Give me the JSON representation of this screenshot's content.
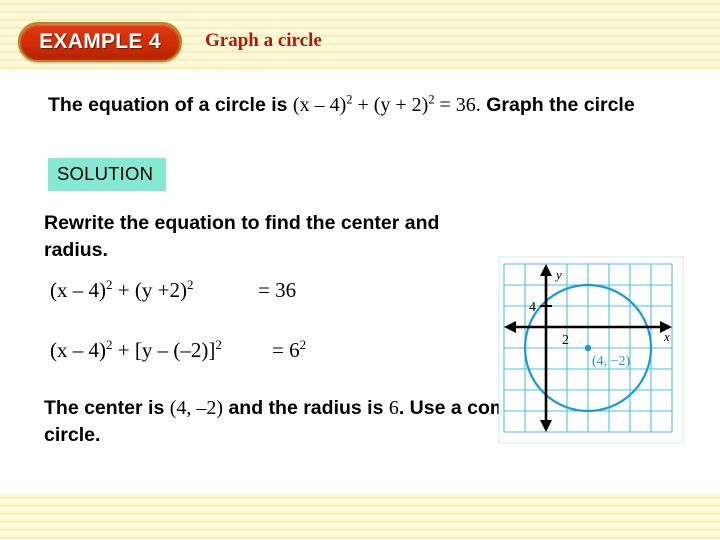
{
  "header": {
    "badge_label": "EXAMPLE 4",
    "title": "Graph a circle"
  },
  "problem": {
    "lead": "The equation of a circle is ",
    "equation": "(x – 4)² + (y + 2)² = 36.",
    "equation_parts": {
      "p1": "(x – 4)",
      "e1": "2",
      "p2": " + (y + 2)",
      "e2": "2",
      "p3": " = 36."
    },
    "trail": " Graph the circle"
  },
  "solution": {
    "label": "SOLUTION",
    "background_color": "#85e8d0"
  },
  "steps": {
    "instruction": "Rewrite the equation to find the center and radius.",
    "equation_1": {
      "lhs_p1": "(x – 4)",
      "lhs_e1": "2",
      "lhs_p2": " + (y +2)",
      "lhs_e2": "2",
      "rhs": "=  36"
    },
    "equation_2": {
      "lhs_p1": "(x – 4)",
      "lhs_e1": "2",
      "lhs_p2": " + [y – (–2)]",
      "lhs_e2": "2",
      "rhs_eq": "=  6",
      "rhs_exp": "2"
    }
  },
  "conclusion": {
    "part1": "The center is ",
    "center": "(4, –2)",
    "part2": " and the radius is ",
    "radius": "6",
    "part3": ". Use a compass to graph the circle."
  },
  "chart_data": {
    "type": "scatter",
    "title": "",
    "xlabel": "x",
    "ylabel": "y",
    "grid": true,
    "grid_step_units": 2,
    "xlim": [
      -4,
      12
    ],
    "ylim": [
      -10,
      6
    ],
    "axis_tick_labels": {
      "y_tick": "4",
      "x_tick": "2"
    },
    "circle": {
      "center_x": 4,
      "center_y": -2,
      "radius": 6,
      "color": "#1b9ad6"
    },
    "center_point_label": "(4, –2)",
    "center_point_color": "#1b9ad6",
    "grid_color": "#4fc0e0",
    "axis_color": "#000000",
    "frame_color": "#5cc8e8"
  }
}
